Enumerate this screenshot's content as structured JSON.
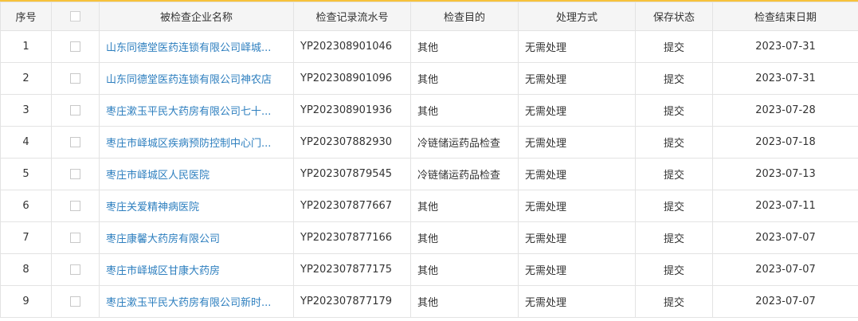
{
  "table": {
    "columns": [
      {
        "key": "index",
        "label": "序号"
      },
      {
        "key": "check",
        "label": ""
      },
      {
        "key": "name",
        "label": "被检查企业名称"
      },
      {
        "key": "serial",
        "label": "检查记录流水号"
      },
      {
        "key": "purpose",
        "label": "检查目的"
      },
      {
        "key": "handling",
        "label": "处理方式"
      },
      {
        "key": "status",
        "label": "保存状态"
      },
      {
        "key": "end_date",
        "label": "检查结束日期"
      }
    ],
    "rows": [
      {
        "index": "1",
        "name": "山东同德堂医药连锁有限公司峄城...",
        "serial": "YP202308901046",
        "purpose": "其他",
        "handling": "无需处理",
        "status": "提交",
        "end_date": "2023-07-31"
      },
      {
        "index": "2",
        "name": "山东同德堂医药连锁有限公司神农店",
        "serial": "YP202308901096",
        "purpose": "其他",
        "handling": "无需处理",
        "status": "提交",
        "end_date": "2023-07-31"
      },
      {
        "index": "3",
        "name": "枣庄漱玉平民大药房有限公司七十...",
        "serial": "YP202308901936",
        "purpose": "其他",
        "handling": "无需处理",
        "status": "提交",
        "end_date": "2023-07-28"
      },
      {
        "index": "4",
        "name": "枣庄市峄城区疾病预防控制中心门...",
        "serial": "YP202307882930",
        "purpose": "冷链储运药品检查",
        "handling": "无需处理",
        "status": "提交",
        "end_date": "2023-07-18"
      },
      {
        "index": "5",
        "name": "枣庄市峄城区人民医院",
        "serial": "YP202307879545",
        "purpose": "冷链储运药品检查",
        "handling": "无需处理",
        "status": "提交",
        "end_date": "2023-07-13"
      },
      {
        "index": "6",
        "name": "枣庄关爱精神病医院",
        "serial": "YP202307877667",
        "purpose": "其他",
        "handling": "无需处理",
        "status": "提交",
        "end_date": "2023-07-11"
      },
      {
        "index": "7",
        "name": "枣庄康馨大药房有限公司",
        "serial": "YP202307877166",
        "purpose": "其他",
        "handling": "无需处理",
        "status": "提交",
        "end_date": "2023-07-07"
      },
      {
        "index": "8",
        "name": "枣庄市峄城区甘康大药房",
        "serial": "YP202307877175",
        "purpose": "其他",
        "handling": "无需处理",
        "status": "提交",
        "end_date": "2023-07-07"
      },
      {
        "index": "9",
        "name": "枣庄漱玉平民大药房有限公司新时...",
        "serial": "YP202307877179",
        "purpose": "其他",
        "handling": "无需处理",
        "status": "提交",
        "end_date": "2023-07-07"
      }
    ]
  },
  "colors": {
    "accent_top_border": "#f7c23b",
    "header_bg": "#f5f5f5",
    "link": "#2e7fbf",
    "text": "#333333",
    "grid_line": "#e3e3e3"
  }
}
